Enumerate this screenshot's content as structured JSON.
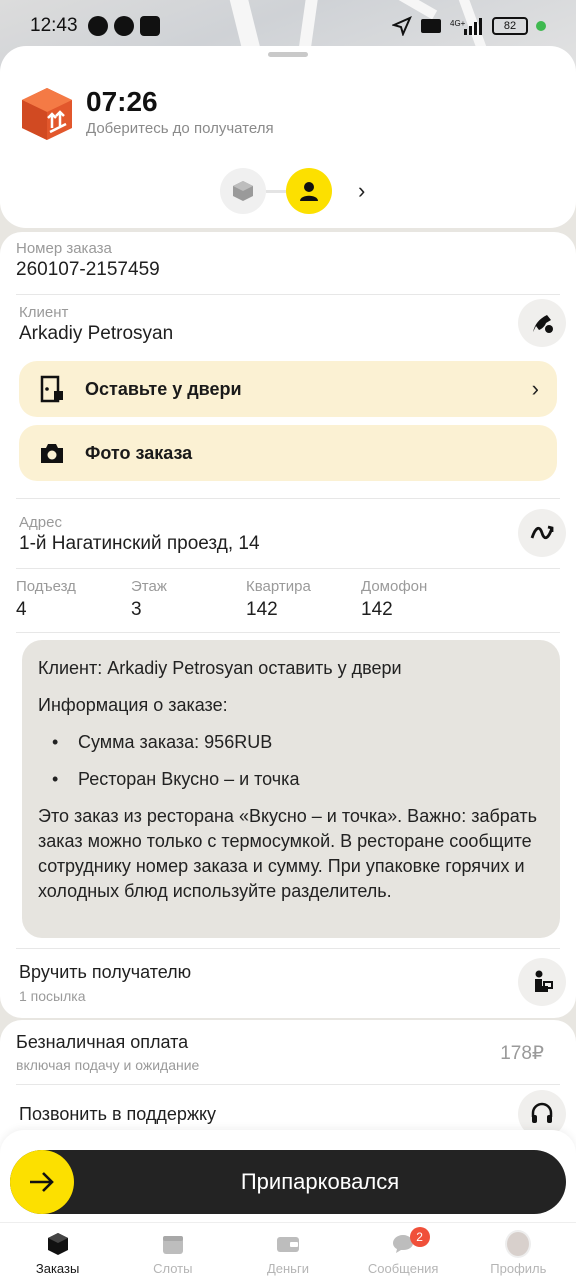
{
  "status_bar": {
    "time": "12:43",
    "battery": "82"
  },
  "header": {
    "eta": "07:26",
    "eta_subtitle": "Доберитесь до получателя"
  },
  "order": {
    "number_label": "Номер заказа",
    "number": "260107-2157459"
  },
  "client": {
    "label": "Клиент",
    "name": "Arkadiy Petrosyan"
  },
  "actions": {
    "leave_at_door": "Оставьте у двери",
    "photo_order": "Фото заказа"
  },
  "address": {
    "label": "Адрес",
    "value": "1-й Нагатинский проезд, 14"
  },
  "details": [
    {
      "label": "Подъезд",
      "value": "4"
    },
    {
      "label": "Этаж",
      "value": "3"
    },
    {
      "label": "Квартира",
      "value": "142"
    },
    {
      "label": "Домофон",
      "value": "142"
    }
  ],
  "comment": {
    "line1": "Клиент: Arkadiy Petrosyan оставить у двери",
    "line2": "Информация о заказе:",
    "bullets": [
      "Сумма заказа: 956RUB",
      "Ресторан Вкусно – и точка"
    ],
    "body": "Это заказ из ресторана «Вкусно – и точка». Важно: забрать заказ можно только с термосумкой. В ресторане сообщите сотруднику номер заказа и сумму. При упаковке горячих и холодных блюд используйте разделитель."
  },
  "handover": {
    "title": "Вручить получателю",
    "subtitle": "1 посылка"
  },
  "payment": {
    "title": "Безналичная оплата",
    "subtitle": "включая подачу и ожидание",
    "amount": "178₽"
  },
  "support": {
    "label": "Позвонить в поддержку"
  },
  "slider": {
    "label": "Припарковался"
  },
  "nav": [
    {
      "label": "Заказы",
      "icon": "orders-icon",
      "active": true
    },
    {
      "label": "Слоты",
      "icon": "calendar-icon",
      "active": false
    },
    {
      "label": "Деньги",
      "icon": "wallet-icon",
      "active": false
    },
    {
      "label": "Сообщения",
      "icon": "chat-icon",
      "active": false,
      "badge": "2"
    },
    {
      "label": "Профиль",
      "icon": "avatar",
      "active": false
    }
  ],
  "colors": {
    "accent": "#fce000",
    "action_bg": "#fbf1d3",
    "slider_bg": "#232323",
    "badge": "#f0503a"
  }
}
